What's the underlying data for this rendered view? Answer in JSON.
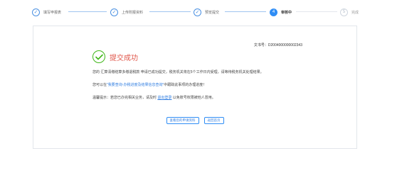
{
  "steps": [
    {
      "number": "1",
      "label": "填写申报表",
      "status": "done"
    },
    {
      "number": "2",
      "label": "上传附报资料",
      "status": "done"
    },
    {
      "number": "3",
      "label": "预览提交",
      "status": "done"
    },
    {
      "number": "4",
      "label": "审核中",
      "status": "active"
    },
    {
      "number": "5",
      "label": "完成",
      "status": "pending"
    }
  ],
  "card": {
    "doc_no_label": "文书号：",
    "doc_no_value": "D2004000000002343",
    "success_title": "提交成功",
    "line1": "您的 汇算清缴结算多缴退税款 申请已成功提交，税务机关将在5个工作日内受理，请等待税务机关处理结果。",
    "line2_prefix": "您可以在",
    "line2_link": "\"我要查询-办税进度及结果信息查询\"",
    "line2_suffix": "中跟踪此事项的办理进度！",
    "line3_prefix": "温馨提示：若您已办完相关业务，请及时 ",
    "line3_link": "退出登录",
    "line3_suffix": " 以免账号权限被他人冒用。",
    "buttons": {
      "view_submitted": "查看您的申请资料",
      "return": "返回首页"
    }
  },
  "colors": {
    "accent": "#2f8df5",
    "success": "#3fb618",
    "title_red": "#e0564a"
  }
}
